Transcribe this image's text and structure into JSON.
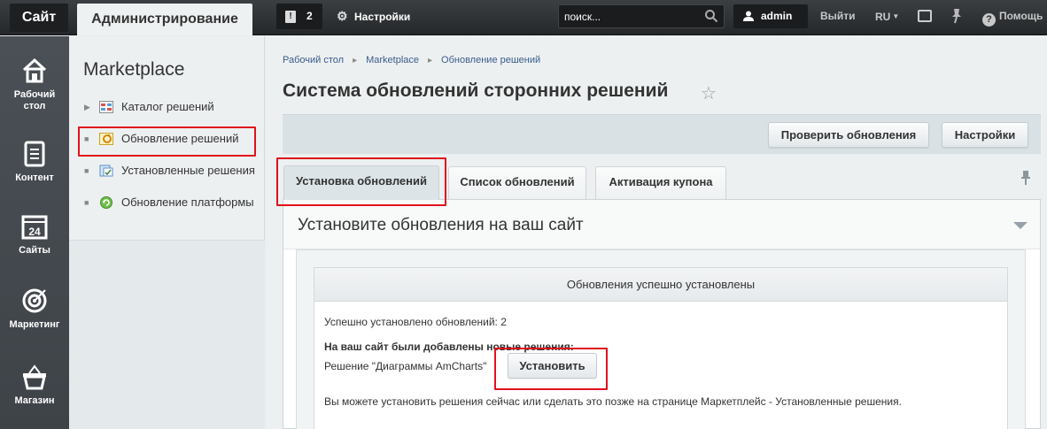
{
  "topbar": {
    "site_label": "Сайт",
    "admin_label": "Администрирование",
    "notifications_count": "2",
    "settings_label": "Настройки",
    "search_placeholder": "поиск...",
    "user_label": "admin",
    "logout_label": "Выйти",
    "lang_label": "RU",
    "help_label": "Помощь"
  },
  "iconbar": {
    "items": [
      {
        "label_line1": "Рабочий",
        "label_line2": "стол",
        "icon": "home-icon"
      },
      {
        "label_line1": "Контент",
        "icon": "document-icon"
      },
      {
        "label_line1": "Сайты",
        "icon": "calendar-icon"
      },
      {
        "label_line1": "Маркетинг",
        "icon": "target-icon"
      },
      {
        "label_line1": "Магазин",
        "icon": "basket-icon"
      }
    ]
  },
  "menu": {
    "title": "Marketplace",
    "items": [
      {
        "label": "Каталог решений",
        "icon": "catalog-icon"
      },
      {
        "label": "Обновление решений",
        "icon": "update-solutions-icon"
      },
      {
        "label": "Установленные решения",
        "icon": "installed-solutions-icon"
      },
      {
        "label": "Обновление платформы",
        "icon": "platform-update-icon"
      }
    ]
  },
  "breadcrumb": [
    "Рабочий стол",
    "Marketplace",
    "Обновление решений"
  ],
  "page": {
    "title": "Система обновлений сторонних решений"
  },
  "toolbar": {
    "check_label": "Проверить обновления",
    "settings_label": "Настройки"
  },
  "tabs": [
    {
      "label": "Установка обновлений"
    },
    {
      "label": "Список обновлений"
    },
    {
      "label": "Активация купона"
    }
  ],
  "panel": {
    "title": "Установите обновления на ваш сайт",
    "box_title": "Обновления успешно установлены",
    "installed_count_text": "Успешно установлено обновлений: 2",
    "new_solutions_heading": "На ваш сайт были добавлены новые решения:",
    "solution_text": "Решение \"Диаграммы AmCharts\"",
    "install_label": "Установить",
    "footer_text": "Вы можете установить решения сейчас или сделать это позже на странице Маркетплейс - Установленные решения."
  },
  "colors": {
    "highlight": "#e0121c",
    "topbar": "#2b2e30",
    "iconbar": "#454b50"
  }
}
